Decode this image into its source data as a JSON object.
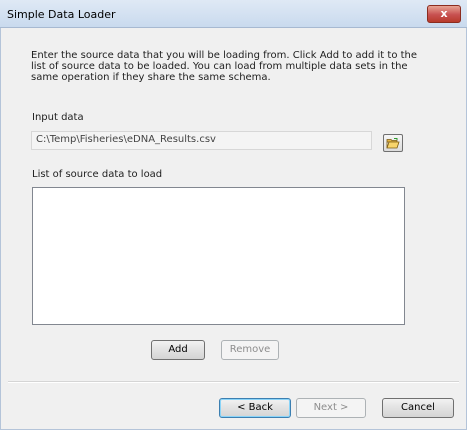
{
  "window": {
    "title": "Simple Data Loader",
    "close_label": "x"
  },
  "instructions": "Enter the source data that you will be loading from. Click Add to add it to the list of source data to be loaded. You can load from multiple data sets in the same operation if they share the same schema.",
  "input": {
    "label": "Input data",
    "value": "C:\\Temp\\Fisheries\\eDNA_Results.csv",
    "browse_icon": "open-folder-icon"
  },
  "source_list": {
    "label": "List of source data to load",
    "items": []
  },
  "buttons": {
    "add": "Add",
    "remove": "Remove",
    "back": "< Back",
    "next": "Next >",
    "cancel": "Cancel"
  },
  "colors": {
    "title_bar": "#c9daee",
    "close_button": "#c75050",
    "window_bg": "#f0f0f0"
  }
}
